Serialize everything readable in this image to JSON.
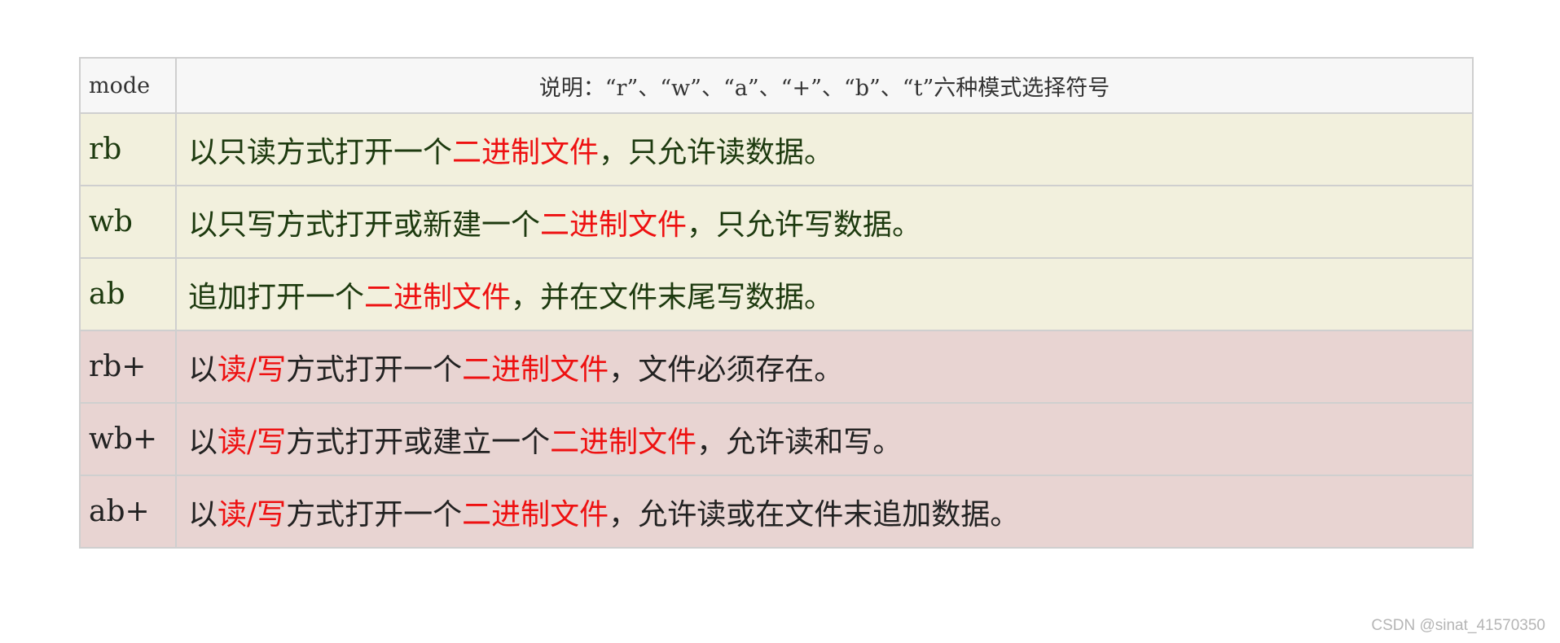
{
  "header": {
    "mode_label": "mode",
    "desc_label": "说明：“r”、“w”、“a”、“+”、“b”、“t”六种模式选择符号"
  },
  "colors": {
    "highlight": "#ee1111",
    "group_read_write_only_bg": "#f2f0dd",
    "group_plus_bg": "#e8d4d2"
  },
  "rows": [
    {
      "mode": "rb",
      "segments": [
        {
          "text": "以只读方式打开一个"
        },
        {
          "text": "二进制文件",
          "highlight": true
        },
        {
          "text": "，只允许读数据。"
        }
      ]
    },
    {
      "mode": "wb",
      "segments": [
        {
          "text": "以只写方式打开或新建一个"
        },
        {
          "text": "二进制文件",
          "highlight": true
        },
        {
          "text": "，只允许写数据。"
        }
      ]
    },
    {
      "mode": "ab",
      "segments": [
        {
          "text": "追加打开一个"
        },
        {
          "text": "二进制文件",
          "highlight": true
        },
        {
          "text": "，并在文件末尾写数据。"
        }
      ]
    },
    {
      "mode": "rb+",
      "segments": [
        {
          "text": "以"
        },
        {
          "text": "读/写",
          "highlight": true
        },
        {
          "text": "方式打开一个"
        },
        {
          "text": "二进制文件",
          "highlight": true
        },
        {
          "text": "，文件必须存在。"
        }
      ]
    },
    {
      "mode": "wb+",
      "segments": [
        {
          "text": "以"
        },
        {
          "text": "读/写",
          "highlight": true
        },
        {
          "text": "方式打开或建立一个"
        },
        {
          "text": "二进制文件",
          "highlight": true
        },
        {
          "text": "，允许读和写。"
        }
      ]
    },
    {
      "mode": "ab+",
      "segments": [
        {
          "text": "以"
        },
        {
          "text": "读/写",
          "highlight": true
        },
        {
          "text": "方式打开一个"
        },
        {
          "text": "二进制文件",
          "highlight": true
        },
        {
          "text": "，允许读或在文件末追加数据。"
        }
      ]
    }
  ],
  "watermark": "CSDN @sinat_41570350"
}
